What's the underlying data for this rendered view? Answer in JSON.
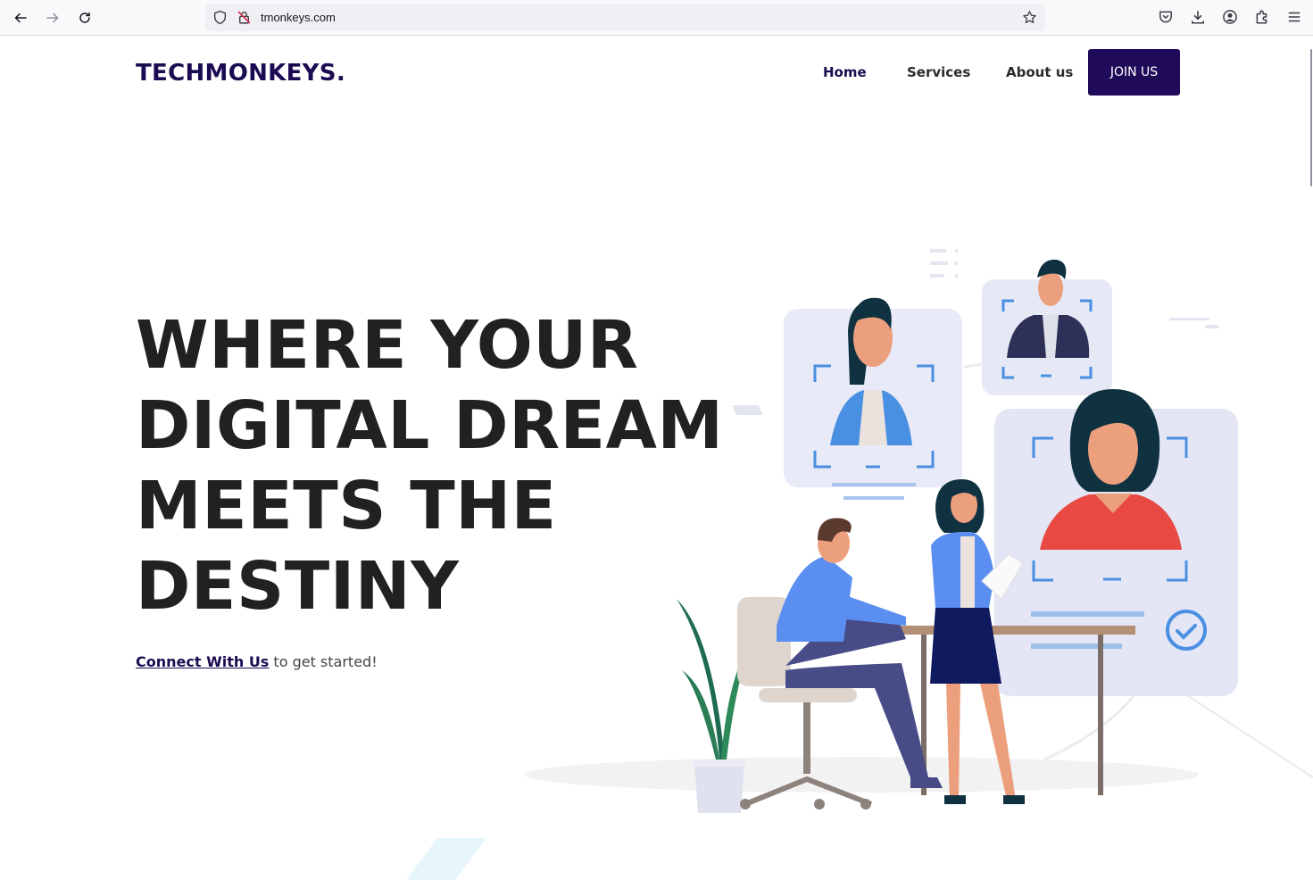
{
  "browser": {
    "url": "tmonkeys.com",
    "icons": [
      "back-icon",
      "forward-icon",
      "reload-icon",
      "shield-icon",
      "insecure-lock-icon",
      "bookmark-star-icon",
      "pocket-icon",
      "download-icon",
      "account-icon",
      "extensions-icon",
      "menu-icon"
    ]
  },
  "site": {
    "logo": "TECHMONKEYS.",
    "nav": {
      "home": "Home",
      "services": "Services",
      "about": "About us",
      "join": "JOIN US"
    },
    "hero": {
      "lines": [
        "WHERE YOUR",
        "DIGITAL DREAM",
        "MEETS THE",
        "DESTINY"
      ]
    },
    "cta": {
      "link": "Connect With Us",
      "rest": " to get started!"
    }
  },
  "colors": {
    "brand": "#1b0b52",
    "button": "#200a5a",
    "heading": "#212121",
    "illustration_blue": "#5a8ef0",
    "illustration_red": "#e84a43"
  }
}
